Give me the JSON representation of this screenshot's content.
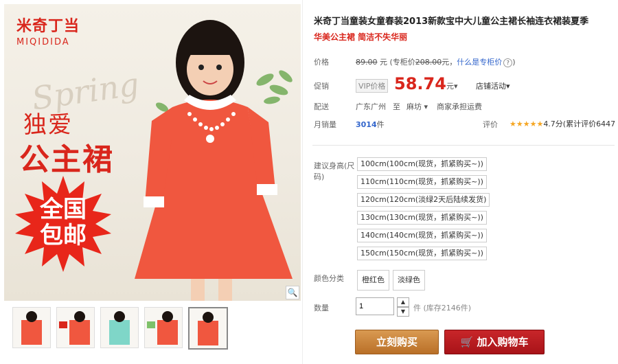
{
  "image": {
    "brand_cn": "米奇丁当",
    "brand_en": "MIQIDIDA",
    "spring_text": "Spring",
    "slogan_line1": "独爱",
    "slogan_line2": "公主裙",
    "badge_line1": "全国",
    "badge_line2": "包邮",
    "zoom_icon": "🔍"
  },
  "product": {
    "title": "米奇丁当童装女童春装2013新款宝中大儿童公主裙长袖连衣裙装夏季",
    "subtitle": "华美公主裙 简洁不失华丽"
  },
  "price_row": {
    "label": "价格",
    "original": "89.00",
    "unit": "元",
    "counter_prefix": "(专柜价",
    "counter_price": "208.00",
    "counter_suffix": "元，",
    "what_is": "什么是专柜价",
    "what_is_icon": "?",
    "close_paren": ")"
  },
  "promo_row": {
    "label": "促销",
    "vip_tag": "VIP价格",
    "price": "58.74",
    "unit": "元",
    "chevron": "▾",
    "store_activity": "店铺活动",
    "store_chevron": "▾"
  },
  "ship_row": {
    "label": "配送",
    "from": "广东广州",
    "to_word": "至",
    "dest": "麻坊",
    "chevron": "▾",
    "carrier": "商家承担运费"
  },
  "sales_row": {
    "label": "月销量",
    "count": "3014",
    "unit": "件",
    "rating_label": "评价",
    "stars": "★★★★★",
    "score": "4.7分(累计评价6447"
  },
  "sizes": {
    "label": "建议身高(尺码)",
    "options": [
      "100cm(100cm(现货，抓紧购买~))",
      "110cm(110cm(现货，抓紧购买~))",
      "120cm(120cm(淡绿2天后陆续发货)",
      "130cm(130cm(现货，抓紧购买~))",
      "140cm(140cm(现货，抓紧购买~))",
      "150cm(150cm(现货，抓紧购买~))"
    ]
  },
  "colors": {
    "label": "颜色分类",
    "options": [
      "橙红色",
      "淡绿色"
    ]
  },
  "quantity": {
    "label": "数量",
    "value": "1",
    "stock_text": "件 (库存2146件)",
    "up": "▲",
    "down": "▼"
  },
  "actions": {
    "buy_now": "立刻购买",
    "add_cart": "加入购物车",
    "cart_icon": "🛒"
  },
  "colors_ui": {
    "accent_red": "#d9261c",
    "buy_orange": "#c07a33",
    "cart_red": "#b5171c"
  }
}
